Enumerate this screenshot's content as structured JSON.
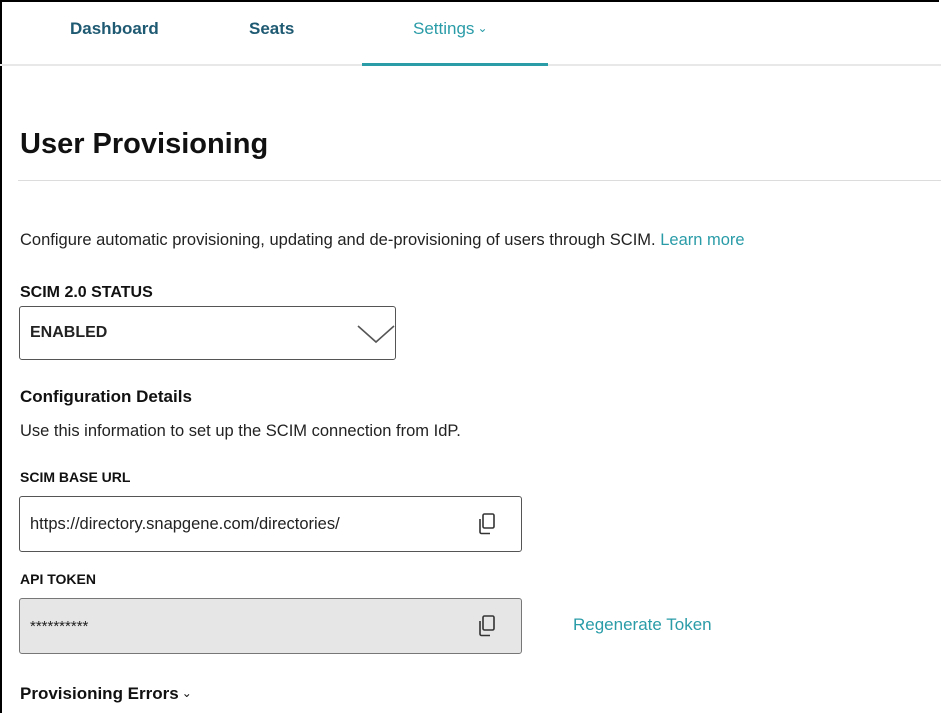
{
  "nav": {
    "tabs": [
      {
        "label": "Dashboard"
      },
      {
        "label": "Seats"
      },
      {
        "label": "Settings",
        "active": true
      }
    ],
    "settings_chevron": "⌄"
  },
  "page": {
    "title": "User Provisioning",
    "intro": "Configure automatic provisioning, updating and de-provisioning of users through SCIM.",
    "learn_more": "Learn more"
  },
  "scim_status": {
    "label": "SCIM 2.0 STATUS",
    "selected": "ENABLED"
  },
  "config": {
    "title": "Configuration Details",
    "description": "Use this information to set up the SCIM connection from IdP."
  },
  "base_url": {
    "label": "SCIM BASE URL",
    "value": "https://directory.snapgene.com/directories/"
  },
  "api_token": {
    "label": "API TOKEN",
    "value": "**********"
  },
  "regenerate_label": "Regenerate Token",
  "provisioning_errors": {
    "label": "Provisioning Errors",
    "chevron": "⌄"
  },
  "colors": {
    "accent": "#2a9ca8",
    "nav_text": "#1f5a73",
    "token_bg": "#e6e6e6"
  },
  "icons": [
    "chevron-down-icon",
    "copy-icon"
  ]
}
